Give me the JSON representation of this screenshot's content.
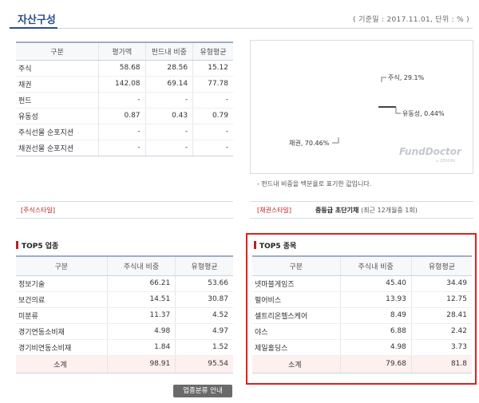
{
  "header": {
    "title": "자산구성",
    "basis": "( 기준일 : 2017.11.01, 단위 : % )"
  },
  "asset_table": {
    "headers": [
      "구분",
      "평가액",
      "펀드내 비중",
      "유형평균"
    ],
    "rows": [
      [
        "주식",
        "58.68",
        "28.56",
        "15.12"
      ],
      [
        "채권",
        "142.08",
        "69.14",
        "77.78"
      ],
      [
        "펀드",
        "-",
        "-",
        "-"
      ],
      [
        "유동성",
        "0.87",
        "0.43",
        "0.79"
      ],
      [
        "주식선물 순포지션",
        "-",
        "-",
        "-"
      ],
      [
        "채권선물 순포지션",
        "-",
        "-",
        "-"
      ]
    ]
  },
  "chart": {
    "labels": {
      "stock": "주식, 29.1%",
      "liquidity": "유동성, 0.44%",
      "bond": "채권, 70.46%"
    },
    "watermark": "FundDoctor",
    "watermark_sub": "a ZEROIN",
    "note": "- 펀드내 비중을 백분율로 표기한 값입니다."
  },
  "chart_data": {
    "type": "pie",
    "categories": [
      "주식",
      "유동성",
      "채권"
    ],
    "values": [
      29.1,
      0.44,
      70.46
    ]
  },
  "style": {
    "stock_label": "[주식스타일]",
    "bond_label": "[채권스타일]",
    "bond_value": "중등급 초단기채",
    "bond_sub": "(최근 12개월중 1회)"
  },
  "top5_industry": {
    "title": "TOP5 업종",
    "headers": [
      "구분",
      "주식내 비중",
      "유형평균"
    ],
    "rows": [
      [
        "정보기술",
        "66.21",
        "53.66"
      ],
      [
        "보건의료",
        "14.51",
        "30.87"
      ],
      [
        "미분류",
        "11.37",
        "4.52"
      ],
      [
        "경기연동소비재",
        "4.98",
        "4.97"
      ],
      [
        "경기비연동소비재",
        "1.84",
        "1.52"
      ]
    ],
    "total": [
      "소계",
      "98.91",
      "95.54"
    ],
    "guide_button": "업종분류 안내"
  },
  "top5_stocks": {
    "title": "TOP5 종목",
    "headers": [
      "구분",
      "주식내 비중",
      "유형평균"
    ],
    "rows": [
      [
        "넷마블게임즈",
        "45.40",
        "34.49"
      ],
      [
        "펄어비스",
        "13.93",
        "12.75"
      ],
      [
        "셀트리온헬스케어",
        "8.49",
        "28.41"
      ],
      [
        "야스",
        "6.88",
        "2.42"
      ],
      [
        "제일홀딩스",
        "4.98",
        "3.73"
      ]
    ],
    "total": [
      "소계",
      "79.68",
      "81.8"
    ]
  }
}
